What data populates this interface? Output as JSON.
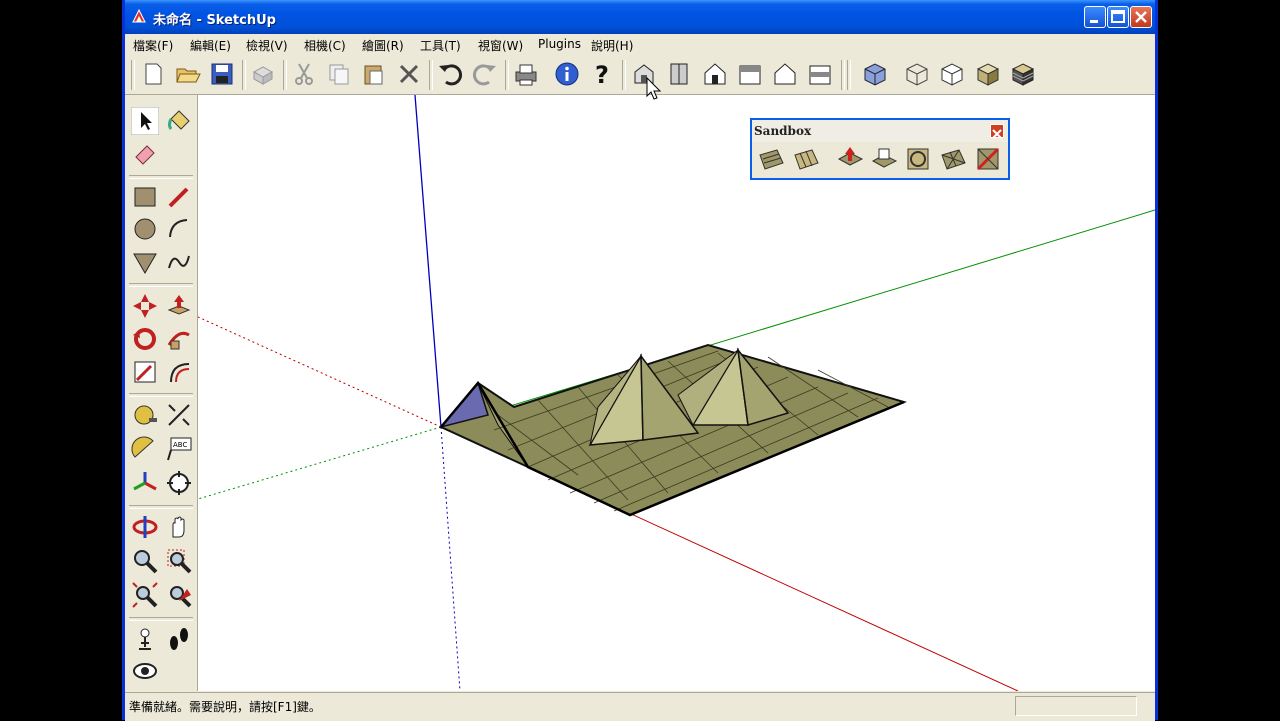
{
  "window": {
    "title": "未命名 - SketchUp",
    "app_icon": "sketchup-icon",
    "caption_buttons": [
      "minimize-icon",
      "maximize-icon",
      "close-icon"
    ]
  },
  "menubar": {
    "items": [
      "檔案(F)",
      "編輯(E)",
      "檢視(V)",
      "相機(C)",
      "繪圖(R)",
      "工具(T)",
      "視窗(W)",
      "Plugins",
      "說明(H)"
    ]
  },
  "toolbar": {
    "buttons": [
      "new-icon",
      "open-icon",
      "save-icon",
      "make-component-icon",
      "cut-icon",
      "copy-icon",
      "paste-icon",
      "erase-icon",
      "undo-icon",
      "redo-icon",
      "print-icon",
      "model-info-icon",
      "help-icon",
      "iso-view-icon",
      "top-view-icon",
      "front-view-icon",
      "right-view-icon",
      "back-view-icon",
      "left-view-icon",
      "xray-icon",
      "wireframe-icon",
      "hidden-line-icon",
      "shaded-icon",
      "shaded-texture-icon"
    ]
  },
  "left_tools": {
    "buttons": [
      "select-icon",
      "paint-bucket-icon",
      "eraser-icon",
      "rectangle-icon",
      "line-icon",
      "circle-icon",
      "arc-icon",
      "polygon-icon",
      "freehand-icon",
      "move-icon",
      "push-pull-icon",
      "rotate-icon",
      "follow-me-icon",
      "scale-icon",
      "offset-icon",
      "tape-measure-icon",
      "dimension-icon",
      "protractor-icon",
      "text-icon",
      "axes-icon",
      "3d-text-icon",
      "orbit-icon",
      "pan-icon",
      "zoom-icon",
      "zoom-window-icon",
      "zoom-extents-icon",
      "previous-view-icon",
      "position-camera-icon",
      "walk-icon",
      "look-around-icon"
    ]
  },
  "sandbox": {
    "title": "Sandbox",
    "tools": [
      "from-contours-icon",
      "from-scratch-icon",
      "smoove-icon",
      "stamp-icon",
      "drape-icon",
      "add-detail-icon",
      "flip-edge-icon"
    ]
  },
  "statusbar": {
    "text": "準備就緒。需要說明，請按[F1]鍵。"
  },
  "colors": {
    "axis_red": "#c00000",
    "axis_green": "#009000",
    "axis_blue": "#0000c0",
    "terrain_fill": "#8c8c5a",
    "terrain_light": "#bcbc86",
    "titlebar_blue": "#0054e3"
  }
}
